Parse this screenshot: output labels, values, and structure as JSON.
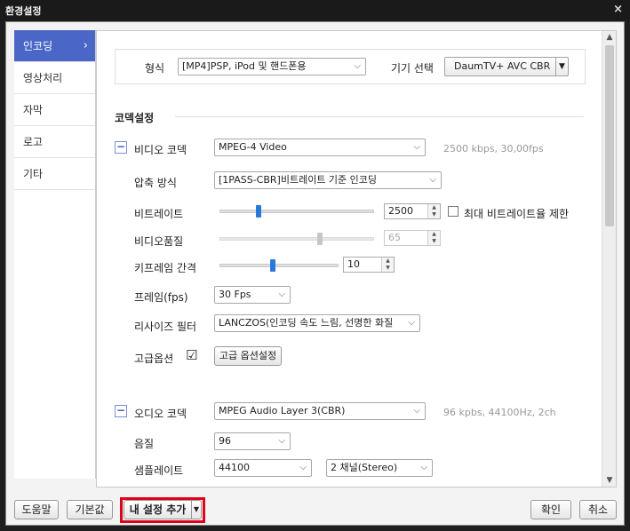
{
  "window": {
    "title": "환경설정",
    "close_glyph": "×"
  },
  "sidebar": {
    "items": [
      {
        "label": "인코딩",
        "chevron": "›"
      },
      {
        "label": "영상처리"
      },
      {
        "label": "자막"
      },
      {
        "label": "로고"
      },
      {
        "label": "기타"
      }
    ]
  },
  "format": {
    "label": "형식",
    "value": "[MP4]PSP, iPod 및 핸드폰용",
    "device_label": "기기 선택",
    "device_value": "DaumTV+ AVC CBR"
  },
  "codec_section": {
    "title": "코덱설정"
  },
  "video": {
    "toggle": "−",
    "label": "비디오 코덱",
    "value": "MPEG-4 Video",
    "summary": "2500 kbps, 30,00fps",
    "compression_label": "압축 방식",
    "compression_value": "[1PASS-CBR]비트레이트 기준 인코딩",
    "bitrate_label": "비트레이트",
    "bitrate_value": "2500",
    "bitrate_level": 0.25,
    "max_bitrate_label": "최대 비트레이트율 제한",
    "quality_label": "비디오품질",
    "quality_value": "65",
    "quality_level": 0.65,
    "keyframe_label": "키프레임 간격",
    "keyframe_value": "10",
    "keyframe_level": 0.45,
    "fps_label": "프레임(fps)",
    "fps_value": "30 Fps",
    "resize_label": "리사이즈 필터",
    "resize_value": "LANCZOS(인코딩 속도 느림, 선명한 화질",
    "advanced_label": "고급옵션",
    "advanced_checked": "☑",
    "advanced_button": "고급 옵션설정"
  },
  "audio": {
    "toggle": "−",
    "label": "오디오 코덱",
    "value": "MPEG Audio Layer 3(CBR)",
    "summary": "96 kpbs, 44100Hz, 2ch",
    "quality_label": "음질",
    "quality_value": "96",
    "samplerate_label": "샘플레이트",
    "samplerate_value": "44100",
    "channels_value": "2 채널(Stereo)"
  },
  "footer": {
    "help": "도움말",
    "default": "기본값",
    "add_my_setting": "내 설정 추가",
    "ok": "확인",
    "cancel": "취소"
  },
  "colors": {
    "accent": "#4a67c7",
    "highlight": "#e0001a",
    "slider": "#2a78d8"
  }
}
